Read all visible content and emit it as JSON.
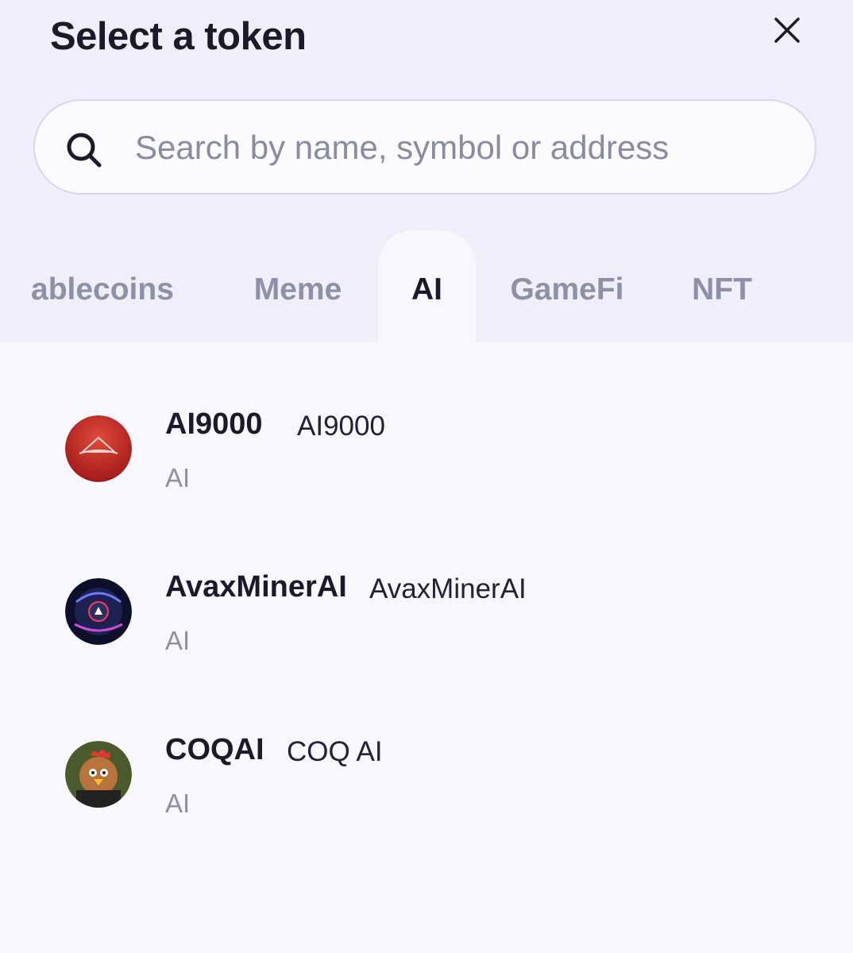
{
  "modal": {
    "title": "Select a token"
  },
  "search": {
    "placeholder": "Search by name, symbol or address",
    "value": ""
  },
  "tabs": [
    {
      "label": "Stablecoins",
      "active": false
    },
    {
      "label": "Meme",
      "active": false
    },
    {
      "label": "AI",
      "active": true
    },
    {
      "label": "GameFi",
      "active": false
    },
    {
      "label": "NFT",
      "active": false
    }
  ],
  "tokens": [
    {
      "symbol": "AI9000",
      "name": "AI9000",
      "category": "AI",
      "icon": "ai9000-logo-icon"
    },
    {
      "symbol": "AvaxMinerAI",
      "name": "AvaxMinerAI",
      "category": "AI",
      "icon": "avaxminerai-logo-icon"
    },
    {
      "symbol": "COQAI",
      "name": "COQ AI",
      "category": "AI",
      "icon": "coqai-logo-icon"
    }
  ],
  "colors": {
    "header_bg": "#efeef9",
    "list_bg": "#f8f7fd",
    "text_primary": "#1b1a2b",
    "text_muted": "#8f8fa8",
    "search_border": "#d9d5f1"
  }
}
